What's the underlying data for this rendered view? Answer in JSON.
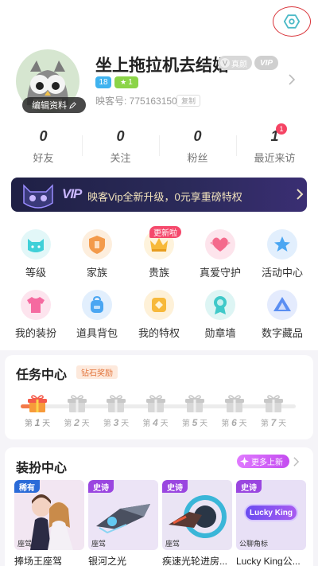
{
  "profile": {
    "nickname": "坐上拖拉机去结婚",
    "verified_tag": "真颜",
    "vip_tag": "VIP",
    "level_badge": "18",
    "star_badge": "1",
    "id_text": "映客号: 775163150",
    "copy_label": "复制",
    "edit_label": "编辑资料"
  },
  "stats": [
    {
      "count": "0",
      "label": "好友"
    },
    {
      "count": "0",
      "label": "关注"
    },
    {
      "count": "0",
      "label": "粉丝"
    },
    {
      "count": "1",
      "label": "最近来访"
    }
  ],
  "recent_visit_badge": "1",
  "vip_banner": {
    "logo": "VIP",
    "text": "映客Vip全新升级，0元享重磅特权"
  },
  "features": [
    {
      "label": "等级",
      "icon": "cat-face-icon",
      "color": "#3fd0d8"
    },
    {
      "label": "家族",
      "icon": "shield-icon",
      "color": "#f39a4a"
    },
    {
      "label": "贵族",
      "icon": "crown-icon",
      "color": "#f7b93a"
    },
    {
      "label": "真爱守护",
      "icon": "heart-icon",
      "color": "#f46a8c"
    },
    {
      "label": "活动中心",
      "icon": "star-icon",
      "color": "#4aa6f2"
    },
    {
      "label": "我的装扮",
      "icon": "tshirt-icon",
      "color": "#f56aa0"
    },
    {
      "label": "道具背包",
      "icon": "backpack-icon",
      "color": "#4aa6f2"
    },
    {
      "label": "我的特权",
      "icon": "diamond-icon",
      "color": "#f7b93a"
    },
    {
      "label": "勋章墙",
      "icon": "medal-icon",
      "color": "#3fc9c9"
    },
    {
      "label": "数字藏品",
      "icon": "collection-icon",
      "color": "#5a8ef2"
    }
  ],
  "nobility_new_tag": "更新啦",
  "task_center": {
    "title": "任务中心",
    "tag": "钻石奖励",
    "day_prefix": "第",
    "day_suffix": "天",
    "days": [
      "1",
      "2",
      "3",
      "4",
      "5",
      "6",
      "7"
    ],
    "progress": 0.04
  },
  "dress_center": {
    "title": "装扮中心",
    "more_label": "更多上新",
    "items": [
      {
        "tier": "稀有",
        "tier_color": "#2a6bd8",
        "type": "座驾",
        "name": "捧场王座驾",
        "bg": "#f2e6f2"
      },
      {
        "tier": "史诗",
        "tier_color": "#9a46e0",
        "type": "座驾",
        "name": "银河之光",
        "bg": "#ece4f6"
      },
      {
        "tier": "史诗",
        "tier_color": "#9a46e0",
        "type": "座驾",
        "name": "疾速光轮进房...",
        "bg": "#eae4f4"
      },
      {
        "tier": "史诗",
        "tier_color": "#9a46e0",
        "type": "公聊角标",
        "name": "Lucky King公...",
        "bg": "#e8e0f6"
      }
    ],
    "badge_text": "Lucky King"
  }
}
